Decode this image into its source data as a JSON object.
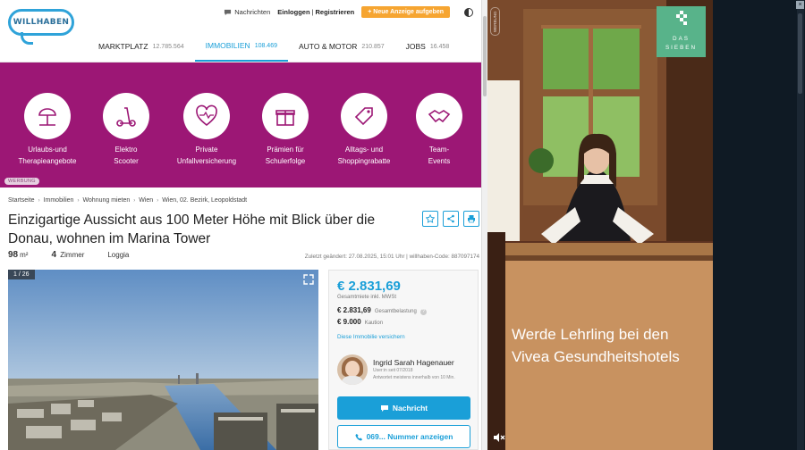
{
  "header": {
    "logo_text": "WILLHABEN",
    "messages_label": "Nachrichten",
    "login_label": "Einloggen",
    "register_label": "Registrieren",
    "separator": "|",
    "new_ad_label": "+ Neue Anzeige aufgeben",
    "nav": [
      {
        "label": "MARKTPLATZ",
        "count": "12.785.564"
      },
      {
        "label": "IMMOBILIEN",
        "count": "108.469"
      },
      {
        "label": "AUTO & MOTOR",
        "count": "210.857"
      },
      {
        "label": "JOBS",
        "count": "16.458"
      }
    ]
  },
  "banner": {
    "background": "#9c1775",
    "tiles": [
      {
        "line1": "Urlaubs-und",
        "line2": "Therapieangebote"
      },
      {
        "line1": "Elektro",
        "line2": "Scooter"
      },
      {
        "line1": "Private",
        "line2": "Unfallversicherung"
      },
      {
        "line1": "Prämien für",
        "line2": "Schulerfolge"
      },
      {
        "line1": "Alltags- und",
        "line2": "Shoppingrabatte"
      },
      {
        "line1": "Team-",
        "line2": "Events"
      }
    ],
    "ad_label": "WERBUNG"
  },
  "breadcrumb": [
    "Startseite",
    "Immobilien",
    "Wohnung mieten",
    "Wien",
    "Wien, 02. Bezirk, Leopoldstadt"
  ],
  "listing": {
    "title": "Einzigartige Aussicht aus 100 Meter Höhe mit Blick über die Donau, wohnen im Marina Tower",
    "area_value": "98",
    "area_unit": "m²",
    "rooms_value": "4",
    "rooms_label": "Zimmer",
    "feature": "Loggia",
    "meta": "Zuletzt geändert: 27.08.2025, 15:01 Uhr | willhaben-Code: 887097174",
    "image_counter": "1 / 26"
  },
  "price": {
    "total": "€ 2.831,69",
    "total_label": "Gesamtmiete inkl. MWSt",
    "burden_value": "€ 2.831,69",
    "burden_label": "Gesamtbelastung",
    "deposit_value": "€ 9.000",
    "deposit_label": "Kaution",
    "compare_link": "Diese Immobilie versichern",
    "seller_name": "Ingrid Sarah Hagenauer",
    "seller_since": "User:in seit 07/2018",
    "seller_response": "Antwortet meistens innerhalb von 10 Min.",
    "message_button": "Nachricht",
    "phone_button": "069... Nummer anzeigen"
  },
  "video_ad": {
    "brand_line1": "DAS",
    "brand_line2": "SIEBEN",
    "caption": "Werde Lehrling bei den Vivea Gesundheitshotels",
    "side_label": "WERBUNG",
    "brand_color": "#58b38a"
  },
  "colors": {
    "accent": "#1a9fd8",
    "cta_orange": "#f6a531"
  }
}
